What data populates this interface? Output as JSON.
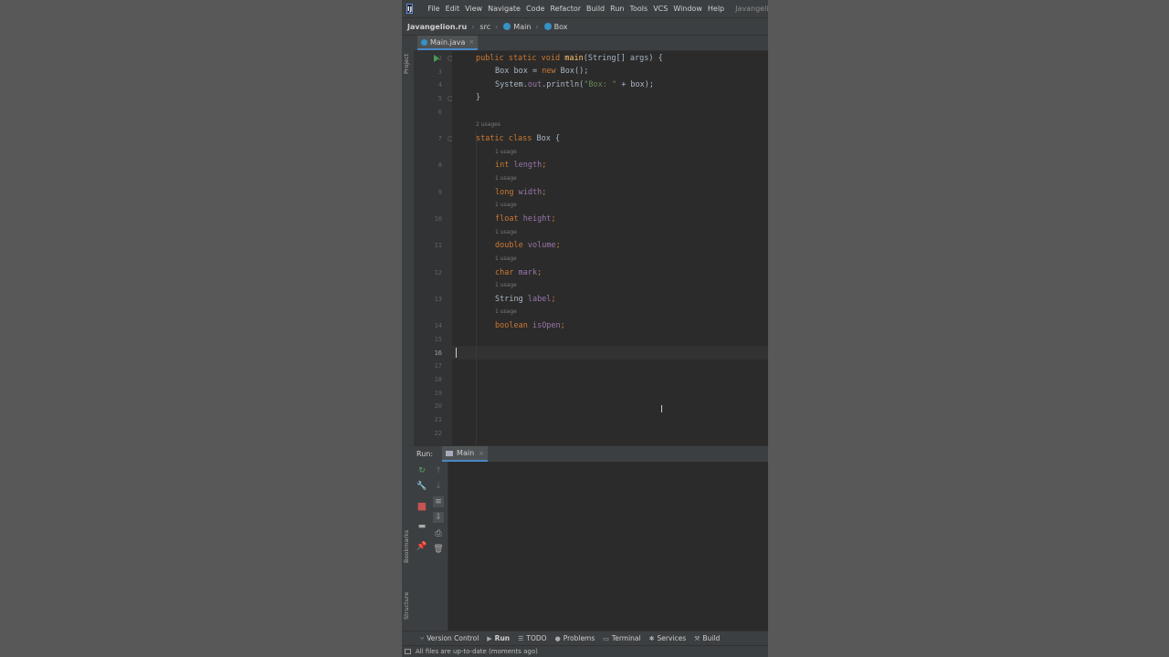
{
  "menubar": {
    "logo": "IJ",
    "items": [
      "File",
      "Edit",
      "View",
      "Navigate",
      "Code",
      "Refactor",
      "Build",
      "Run",
      "Tools",
      "VCS",
      "Window",
      "Help"
    ],
    "title": "Javangeli"
  },
  "breadcrumbs": [
    "Javangelion.ru",
    "src",
    "Main",
    "Box"
  ],
  "left_toolbar": {
    "project": "Project",
    "bookmarks": "Bookmarks",
    "structure": "Structure"
  },
  "tab": {
    "label": "Main.java",
    "close": "×"
  },
  "gutter": {
    "line_numbers": [
      "2",
      "3",
      "4",
      "5",
      "6",
      "7",
      "8",
      "9",
      "10",
      "11",
      "12",
      "13",
      "14",
      "15",
      "16",
      "17",
      "18",
      "19",
      "20",
      "21",
      "22"
    ]
  },
  "code": {
    "main_sig": {
      "kw1": "public static void ",
      "name": "main",
      "rest": "(String[] args) {"
    },
    "box_decl": {
      "pre": "Box box = ",
      "kw": "new",
      "post": " Box();"
    },
    "println": {
      "pre": "System.",
      "out": "out",
      "mid": ".println(",
      "str": "\"Box: \"",
      "post": " + box);"
    },
    "close_brace": "}",
    "class_decl": {
      "kw": "static class ",
      "rest": "Box {"
    },
    "usages_class": "2 usages",
    "usage_hint": "1 usage",
    "fields": [
      {
        "type": "int",
        "name": "length"
      },
      {
        "type": "long",
        "name": "width"
      },
      {
        "type": "float",
        "name": "height"
      },
      {
        "type": "double",
        "name": "volume"
      },
      {
        "type": "char",
        "name": "mark"
      },
      {
        "type": "String",
        "name": "label"
      },
      {
        "type": "boolean",
        "name": "isOpen"
      }
    ]
  },
  "run_panel": {
    "label": "Run:",
    "tab": "Main",
    "close": "×"
  },
  "bottom_tabs": [
    {
      "icon": "branch-icon",
      "label": "Version Control"
    },
    {
      "icon": "run-icon",
      "label": "Run"
    },
    {
      "icon": "list-icon",
      "label": "TODO"
    },
    {
      "icon": "warning-icon",
      "label": "Problems"
    },
    {
      "icon": "terminal-icon",
      "label": "Terminal"
    },
    {
      "icon": "services-icon",
      "label": "Services"
    },
    {
      "icon": "hammer-icon",
      "label": "Build"
    }
  ],
  "status": "All files are up-to-date (moments ago)",
  "colors": {
    "keyword": "#cc7832",
    "function": "#ffc66d",
    "string": "#6a8759",
    "field": "#9876aa",
    "text": "#a9b7c6"
  }
}
